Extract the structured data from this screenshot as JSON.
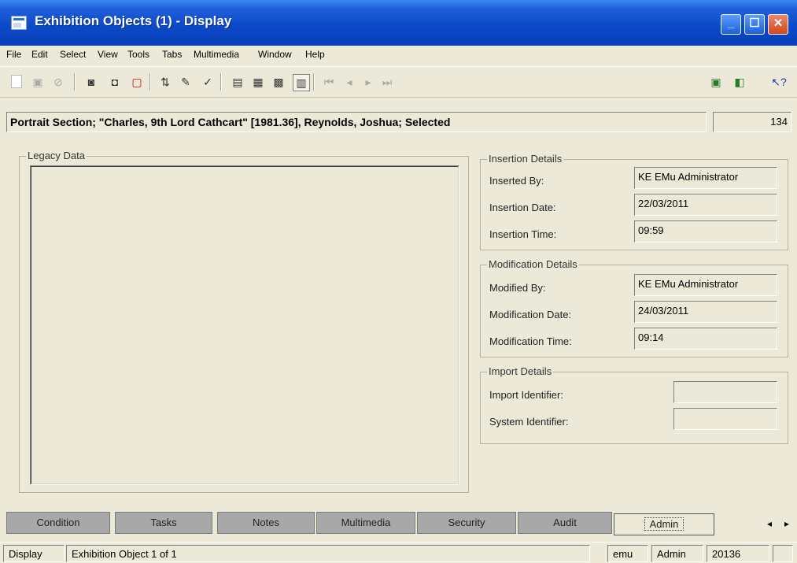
{
  "window": {
    "title": "Exhibition Objects (1) - Display"
  },
  "menu": [
    "File",
    "Edit",
    "Select",
    "View",
    "Tools",
    "Tabs",
    "Multimedia",
    "Window",
    "Help"
  ],
  "record": {
    "summary": "Portrait Section; \"Charles, 9th Lord Cathcart\" [1981.36], Reynolds, Joshua; Selected",
    "count": "134"
  },
  "legacy": {
    "label": "Legacy Data",
    "value": ""
  },
  "insertion": {
    "label": "Insertion Details",
    "inserted_by_label": "Inserted By:",
    "inserted_by": "KE EMu Administrator",
    "date_label": "Insertion Date:",
    "date": "22/03/2011",
    "time_label": "Insertion Time:",
    "time": "09:59"
  },
  "modification": {
    "label": "Modification Details",
    "modified_by_label": "Modified By:",
    "modified_by": "KE EMu Administrator",
    "date_label": "Modification Date:",
    "date": "24/03/2011",
    "time_label": "Modification Time:",
    "time": "09:14"
  },
  "import": {
    "label": "Import Details",
    "import_id_label": "Import Identifier:",
    "import_id": "",
    "system_id_label": "System Identifier:",
    "system_id": ""
  },
  "tabs": [
    "Condition",
    "Tasks",
    "Notes",
    "Multimedia",
    "Security",
    "Audit",
    "Admin"
  ],
  "active_tab": "Admin",
  "status": {
    "mode": "Display",
    "position": "Exhibition Object 1 of 1",
    "user": "emu",
    "group": "Admin",
    "number": "20136"
  },
  "icons": {
    "toolbar": [
      "new-doc-icon",
      "save-icon",
      "cancel-icon",
      "query-icon",
      "query-add-icon",
      "new-record-icon",
      "sort-icon",
      "edit-icon",
      "spell-check-icon",
      "view-details-icon",
      "view-list-icon",
      "view-page-icon",
      "view-contents-icon",
      "first-record-icon",
      "prev-record-icon",
      "next-record-icon",
      "last-record-icon",
      "report-icon",
      "report2-icon",
      "help-pointer-icon"
    ]
  },
  "colors": {
    "titlebar": "#0b48c8",
    "tab_inactive": "#a8a8a8",
    "background": "#ece9d8"
  }
}
